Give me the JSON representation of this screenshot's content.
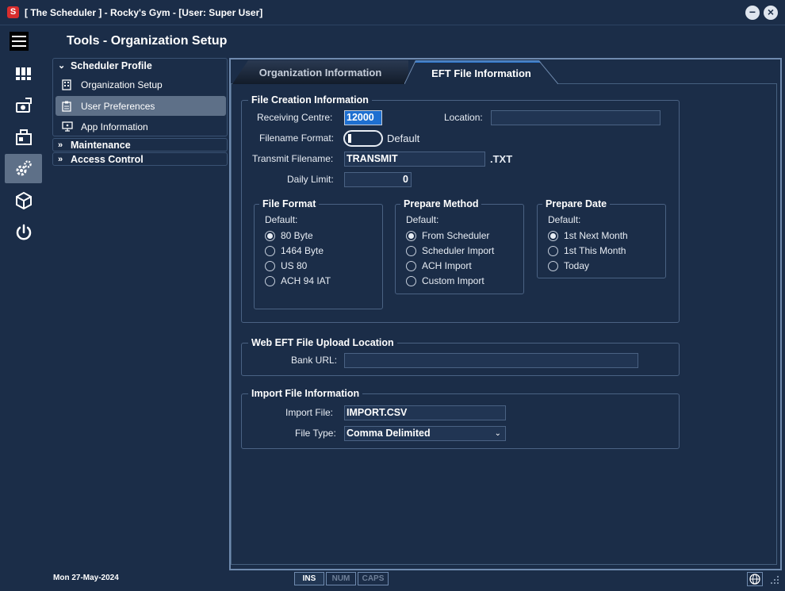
{
  "window": {
    "title": "[ The Scheduler ] - Rocky's Gym - [User: Super User]",
    "logo_letter": "S"
  },
  "page_title": "Tools - Organization Setup",
  "nav": {
    "scheduler_profile": {
      "label": "Scheduler Profile",
      "items": [
        {
          "label": "Organization Setup",
          "icon": "building-icon"
        },
        {
          "label": "User Preferences",
          "icon": "clipboard-icon"
        },
        {
          "label": "App Information",
          "icon": "monitor-info-icon"
        }
      ]
    },
    "maintenance": {
      "label": "Maintenance"
    },
    "access_control": {
      "label": "Access Control"
    }
  },
  "tabs": {
    "organization_information": "Organization Information",
    "eft_file_information": "EFT File Information"
  },
  "file_creation": {
    "title": "File Creation Information",
    "receiving_centre_label": "Receiving Centre:",
    "receiving_centre_value": "12000",
    "location_label": "Location:",
    "location_value": "",
    "filename_format_label": "Filename Format:",
    "filename_format_default": "Default",
    "transmit_filename_label": "Transmit Filename:",
    "transmit_filename_value": "TRANSMIT",
    "transmit_ext": ".TXT",
    "daily_limit_label": "Daily Limit:",
    "daily_limit_value": "0",
    "file_format": {
      "title": "File Format",
      "default_label": "Default:",
      "options": [
        "80 Byte",
        "1464 Byte",
        "US 80",
        "ACH 94 IAT"
      ],
      "selected": 0
    },
    "prepare_method": {
      "title": "Prepare Method",
      "default_label": "Default:",
      "options": [
        "From Scheduler",
        "Scheduler Import",
        "ACH Import",
        "Custom Import"
      ],
      "selected": 0
    },
    "prepare_date": {
      "title": "Prepare Date",
      "default_label": "Default:",
      "options": [
        "1st Next Month",
        "1st This Month",
        "Today"
      ],
      "selected": 0
    }
  },
  "web_eft": {
    "title": "Web EFT File Upload Location",
    "bank_url_label": "Bank URL:",
    "bank_url_value": ""
  },
  "import_file": {
    "title": "Import File Information",
    "import_file_label": "Import File:",
    "import_file_value": "IMPORT.CSV",
    "file_type_label": "File Type:",
    "file_type_value": "Comma Delimited"
  },
  "status": {
    "date": "Mon  27-May-2024",
    "keys": [
      "INS",
      "NUM",
      "CAPS"
    ]
  },
  "colors": {
    "background": "#1b2d48",
    "accent_tab": "#2f7bd3",
    "active_nav": "#5e7088",
    "logo": "#d92d2d"
  }
}
